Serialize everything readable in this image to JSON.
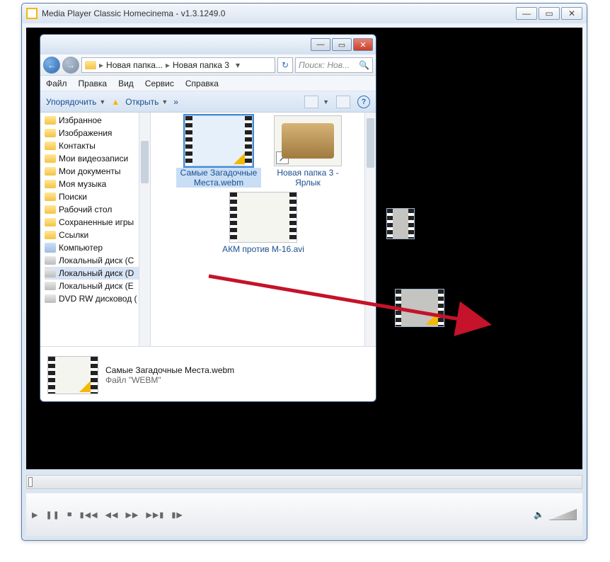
{
  "mpc": {
    "title": "Media Player Classic Homecinema - v1.3.1249.0",
    "controls": {
      "play": "▶",
      "pause": "❚❚",
      "stop": "■",
      "prev": "▮◀◀",
      "rew": "◀◀",
      "fwd": "▶▶",
      "next": "▶▶▮",
      "step": "▮▶"
    },
    "volume_icon": "🔈"
  },
  "explorer": {
    "nav": {
      "back": "←",
      "forward": "→",
      "refresh": "↻"
    },
    "breadcrumb": {
      "c1": "Новая папка...",
      "c2": "Новая папка 3",
      "sep": "▸"
    },
    "search_placeholder": "Поиск: Нов...",
    "menu": {
      "file": "Файл",
      "edit": "Правка",
      "view": "Вид",
      "tools": "Сервис",
      "help": "Справка"
    },
    "toolbar": {
      "organize": "Упорядочить",
      "open": "Открыть",
      "more": "»",
      "help": "?"
    },
    "tree": [
      {
        "icon": "fld",
        "label": "Избранное"
      },
      {
        "icon": "fld",
        "label": "Изображения"
      },
      {
        "icon": "fld",
        "label": "Контакты"
      },
      {
        "icon": "fld",
        "label": "Мои видеозаписи"
      },
      {
        "icon": "fld",
        "label": "Мои документы"
      },
      {
        "icon": "fld",
        "label": "Моя музыка"
      },
      {
        "icon": "fld",
        "label": "Поиски"
      },
      {
        "icon": "fld",
        "label": "Рабочий стол"
      },
      {
        "icon": "fld",
        "label": "Сохраненные игры"
      },
      {
        "icon": "fld",
        "label": "Ссылки"
      },
      {
        "icon": "comp",
        "label": "Компьютер"
      },
      {
        "icon": "drv",
        "label": "Локальный диск (C"
      },
      {
        "icon": "drv",
        "label": "Локальный диск (D",
        "selected": true
      },
      {
        "icon": "drv",
        "label": "Локальный диск (E"
      },
      {
        "icon": "drv",
        "label": "DVD RW дисковод ("
      }
    ],
    "items": [
      {
        "name": "АКМ против M-16.avi",
        "kind": "video"
      },
      {
        "name": "Новая папка 3 - Ярлык",
        "kind": "folder-shortcut"
      },
      {
        "name": "Самые Загадочные Места.webm",
        "kind": "video",
        "selected": true
      }
    ],
    "details": {
      "title": "Самые Загадочные Места.webm",
      "sub": "Файл \"WEBM\""
    }
  }
}
